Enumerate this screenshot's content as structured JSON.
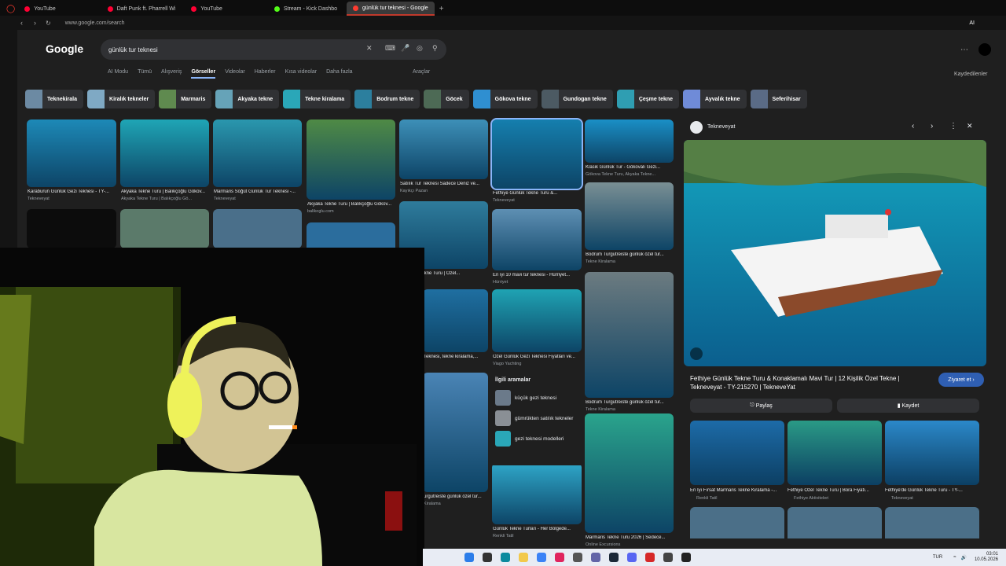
{
  "browser": {
    "tabs": [
      {
        "label": "YouTube",
        "color": "#ff0033"
      },
      {
        "label": "Daft Punk ft. Pharrell Wi",
        "color": "#ff0033"
      },
      {
        "label": "YouTube",
        "color": "#ff0033"
      },
      {
        "label": "Stream - Kick Dashbo",
        "color": "#53fc18"
      },
      {
        "label": "günlük tur teknesi - Google",
        "color": "#ff3b30"
      }
    ],
    "new_tab": "+",
    "url": "www.google.com/search",
    "toolbar_right": "AI"
  },
  "google": {
    "logo": "Google",
    "query": "günlük tur teknesi",
    "filters": [
      "AI Modu",
      "Tümü",
      "Alışveriş",
      "Görseller",
      "Videolar",
      "Haberler",
      "Kısa videolar",
      "Daha fazla"
    ],
    "active_filter": "Görseller",
    "tools": "Araçlar",
    "saved": "Kaydedilenler"
  },
  "chips": [
    "Teknekirala",
    "Kiralık tekneler",
    "Marmaris",
    "Akyaka tekne",
    "Tekne kiralama",
    "Bodrum tekne",
    "Göcek",
    "Gökova tekne",
    "Gundogan tekne",
    "Çeşme tekne",
    "Ayvalık tekne",
    "Seferihisar"
  ],
  "results": [
    {
      "caption": "Karaburun Günlük Gezi Teknesi - TY-...",
      "source": "Tekneveyat"
    },
    {
      "caption": "Akyaka Tekne Turu | Balıkçoğlu Gökov...",
      "source": "Akyaka Tekne Turu | Balıkçoğlu Gö..."
    },
    {
      "caption": "Marmaris Söğüt Günlük Tur Teknesi -...",
      "source": "Tekneveyat"
    },
    {
      "caption": "Akyaka Tekne Turu | Balıkçoğlu Gökov...",
      "source": "balikoglu.com"
    },
    {
      "caption": "Satılık Tur Teknesi Sadece Deniz ve...",
      "source": "Kayıkçı Pazarı"
    },
    {
      "caption": "Fethiye Günlük Tekne Turu &...",
      "source": "Tekneveyat"
    },
    {
      "caption": "Klasik Günlük Tur - Gökovalı Gezi...",
      "source": "Gökova Tekne Turu, Akyaka Tekne..."
    },
    {
      "caption": "r Günlük Tekne Turu | Özel...",
      "source": ""
    },
    {
      "caption": "En iyi 10 mavi tur teknesi - Hürriyet...",
      "source": "Hürriyet"
    },
    {
      "caption": "Bodrum Turgutreiste günlük özel tur...",
      "source": "Tekne Kiralama"
    },
    {
      "caption": "Teknesi, tekne kiralama,...",
      "source": ""
    },
    {
      "caption": "Özel Günlük Gezi Teknesi Fiyatları ve...",
      "source": "Viago Yachting"
    },
    {
      "caption": "Bodrum Turgutreiste günlük özel tur...",
      "source": "Tekne Kiralama"
    },
    {
      "caption": "urgutreiste günlük özel tur...",
      "source": "Kiralama"
    },
    {
      "caption": "Günlük Tekne Turları - Her Bölgede...",
      "source": "Renkli Tatil"
    },
    {
      "caption": "Marmaris Tekne Turu 2026 | Sedece...",
      "source": "Online Excursions"
    }
  ],
  "related": {
    "title": "İlgili aramalar",
    "items": [
      "küçük gezi teknesi",
      "gümrükten satılık tekneler",
      "gezi teknesi modelleri"
    ]
  },
  "panel": {
    "site": "Tekneveyat",
    "title": "Fethiye Günlük Tekne Turu & Konaklamalı Mavi Tur | 12 Kişilik Özel Tekne | Tekneveyat - TY-215270 | TekneveYat",
    "visit": "Ziyaret et",
    "share": "Paylaş",
    "save": "Kaydet",
    "similar": [
      {
        "caption": "En İyi Fırsat Marmaris Tekne Kiralama -...",
        "source": "Renkli Tatil"
      },
      {
        "caption": "Fethiye Özel Tekne Turu | Bora Fiyatı...",
        "source": "Fethiye Aktiviteleri"
      },
      {
        "caption": "Fethiye'de Günlük Tekne Turu - TY-...",
        "source": "Tekneveyat"
      }
    ]
  },
  "taskbar": {
    "lang": "TUR",
    "time": "03:01",
    "date": "10.05.2026"
  }
}
